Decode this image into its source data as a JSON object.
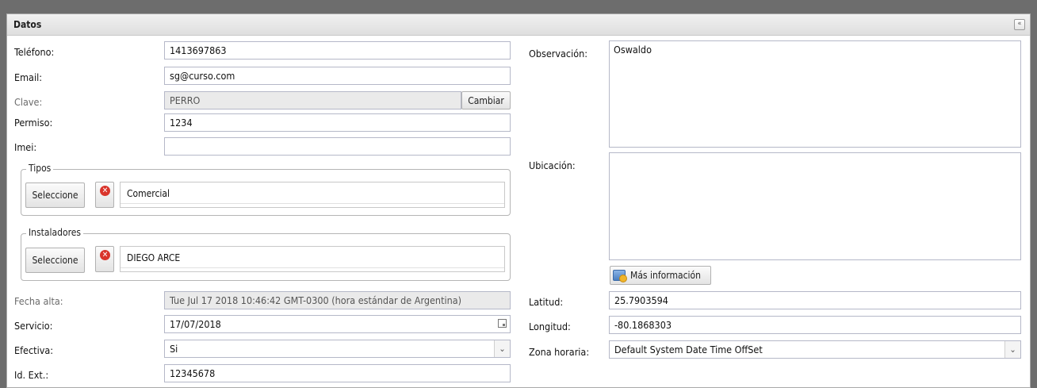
{
  "panel": {
    "title": "Datos",
    "collapse_icon": "double-chevron-up-icon",
    "collapse_glyph": "«"
  },
  "left": {
    "telefono": {
      "label": "Teléfono:",
      "value": "1413697863"
    },
    "email": {
      "label": "Email:",
      "value": "sg@curso.com"
    },
    "clave": {
      "label": "Clave:",
      "value": "PERRO",
      "button": "Cambiar"
    },
    "permiso": {
      "label": "Permiso:",
      "value": "1234"
    },
    "imei": {
      "label": "Imei:",
      "value": ""
    },
    "tipos": {
      "legend": "Tipos",
      "select_button": "Seleccione",
      "item": "Comercial"
    },
    "instaladores": {
      "legend": "Instaladores",
      "select_button": "Seleccione",
      "item": "DIEGO ARCE"
    },
    "fecha_alta": {
      "label": "Fecha alta:",
      "value": "Tue Jul 17 2018 10:46:42 GMT-0300 (hora estándar de Argentina)"
    },
    "servicio": {
      "label": "Servicio:",
      "value": "17/07/2018"
    },
    "efectiva": {
      "label": "Efectiva:",
      "value": "Si"
    },
    "id_ext": {
      "label": "Id. Ext.:",
      "value": "12345678"
    }
  },
  "right": {
    "observacion": {
      "label": "Observación:",
      "value": "Oswaldo"
    },
    "ubicacion": {
      "label": "Ubicación:",
      "value": ""
    },
    "mas_info": {
      "label": "Más información"
    },
    "latitud": {
      "label": "Latitud:",
      "value": "25.7903594"
    },
    "longitud": {
      "label": "Longitud:",
      "value": "-80.1868303"
    },
    "zona_horaria": {
      "label": "Zona horaria:",
      "value": "Default System Date Time OffSet"
    }
  },
  "icons": {
    "delete_glyph": "✕",
    "dropdown_glyph": "⌄"
  }
}
